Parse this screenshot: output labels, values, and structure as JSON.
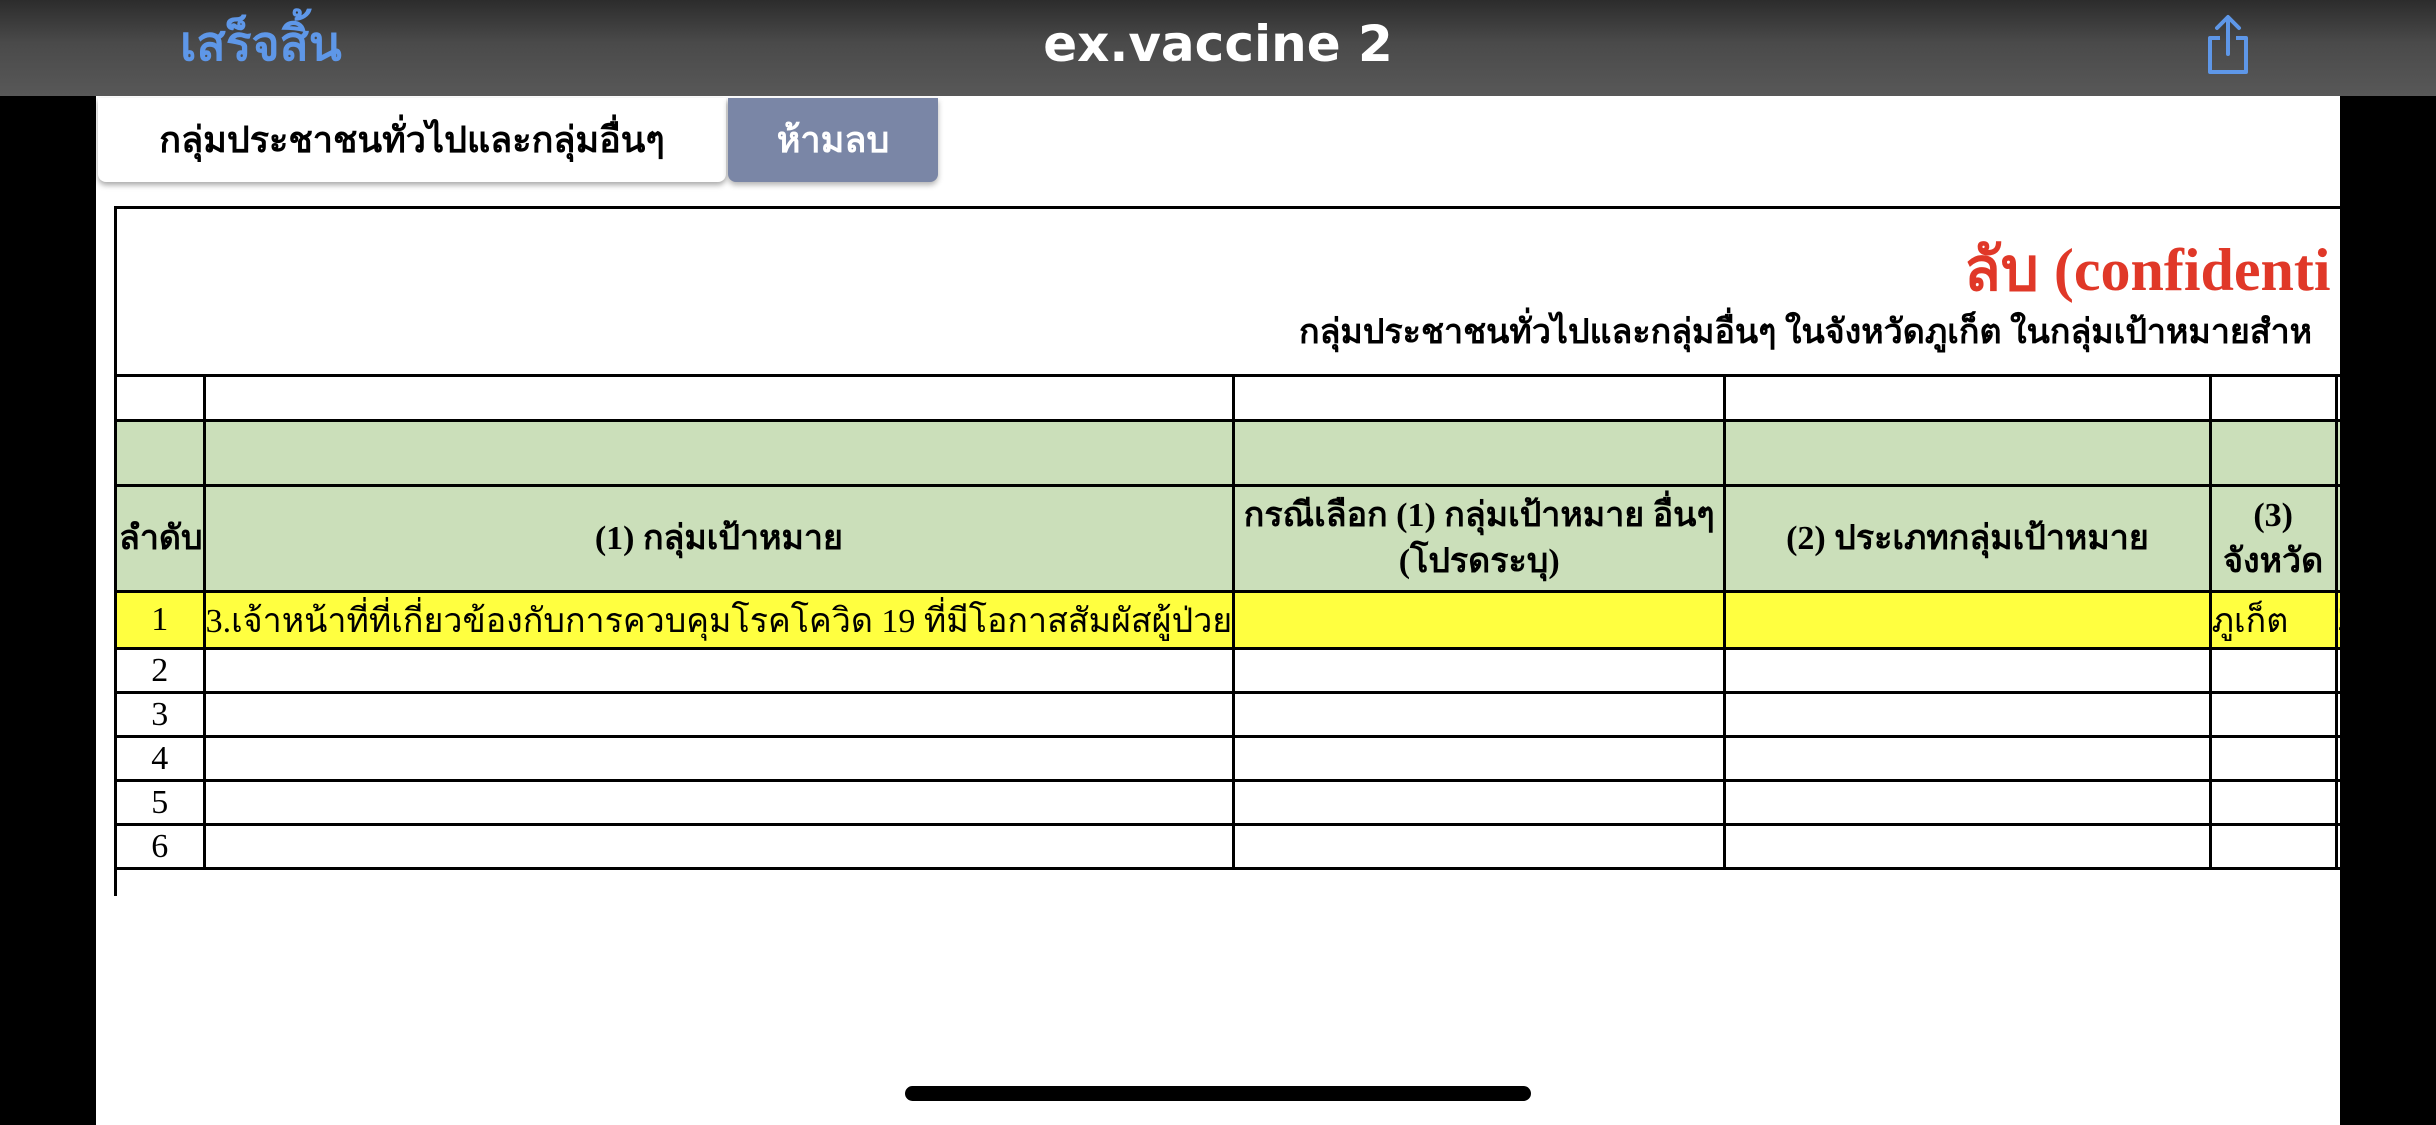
{
  "navbar": {
    "done_label": "เสร็จสิ้น",
    "title": "ex.vaccine 2",
    "share_icon": "share-icon"
  },
  "tabs": [
    {
      "label": "กลุ่มประชาชนทั่วไปและกลุ่มอื่นๆ",
      "active": true
    },
    {
      "label": "ห้ามลบ",
      "active": false
    }
  ],
  "sheet": {
    "confidential_label": "ลับ (confidenti",
    "subtitle": "กลุ่มประชาชนทั่วไปและกลุ่มอื่นๆ ในจังหวัดภูเก็ต ในกลุ่มเป้าหมายสำห",
    "headers": {
      "order": "ลำดับ",
      "target_group": "(1) กลุ่มเป้าหมาย",
      "other_line1": "กรณีเลือก (1) กลุ่มเป้าหมาย อื่นๆ",
      "other_line2": "(โปรดระบุ)",
      "type": "(2) ประเภทกลุ่มเป้าหมาย",
      "province_line1": "(3)",
      "province_line2": "จังหวัด"
    },
    "rows": [
      {
        "no": "1",
        "target_group": "3.เจ้าหน้าที่ที่เกี่ยวข้องกับการควบคุมโรคโควิด 19 ที่มีโอกาสสัมผัสผู้ป่วย",
        "other": "",
        "type": "",
        "province": "ภูเก็ต",
        "next": "2"
      },
      {
        "no": "2",
        "target_group": "",
        "other": "",
        "type": "",
        "province": "",
        "next": ""
      },
      {
        "no": "3",
        "target_group": "",
        "other": "",
        "type": "",
        "province": "",
        "next": ""
      },
      {
        "no": "4",
        "target_group": "",
        "other": "",
        "type": "",
        "province": "",
        "next": ""
      },
      {
        "no": "5",
        "target_group": "",
        "other": "",
        "type": "",
        "province": "",
        "next": ""
      },
      {
        "no": "6",
        "target_group": "",
        "other": "",
        "type": "",
        "province": "",
        "next": ""
      }
    ],
    "colors": {
      "header_fill": "#cbdfba",
      "highlight_fill": "#ffff40",
      "confidential_text": "#e03828",
      "done_text": "#5e97e8"
    }
  }
}
